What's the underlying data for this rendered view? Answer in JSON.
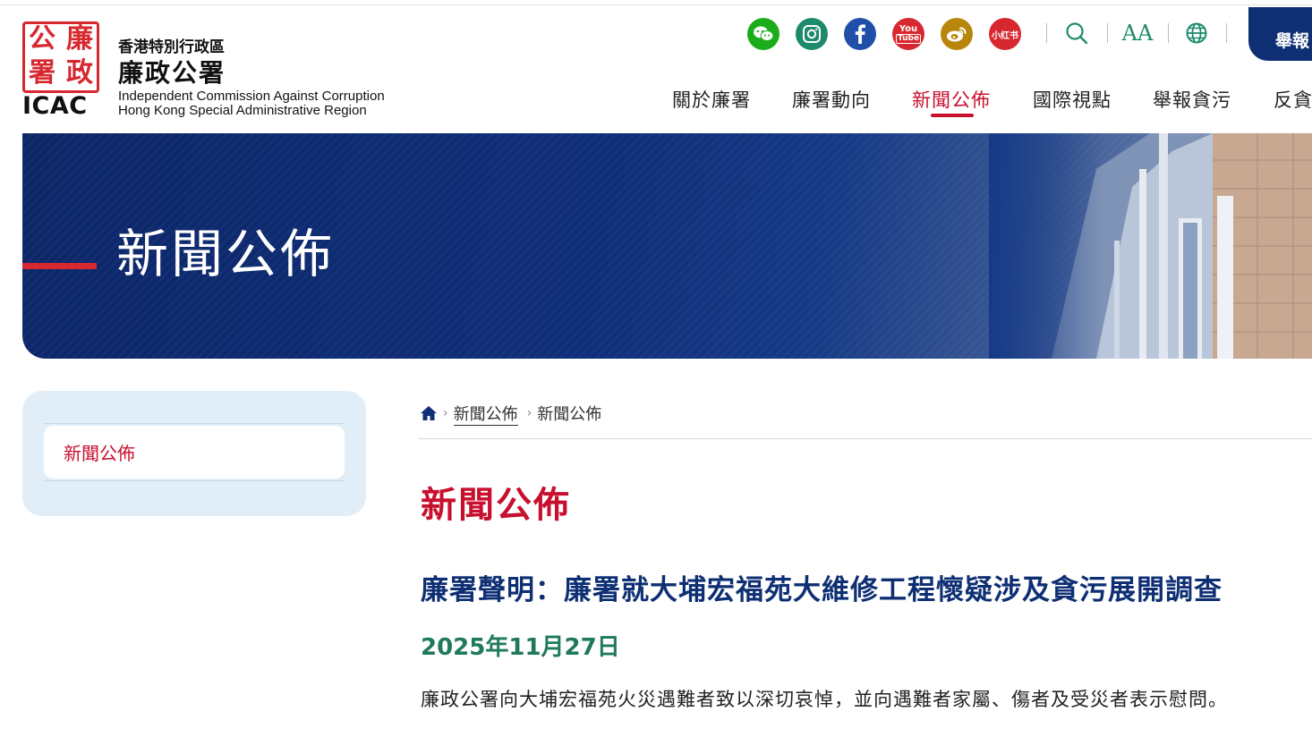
{
  "logo": {
    "seal_chars": [
      "廉",
      "政",
      "公",
      "署"
    ],
    "icac": "ICAC",
    "org_zh_small": "香港特別行政區",
    "org_zh_big": "廉政公署",
    "org_en_line1": "Independent Commission Against Corruption",
    "org_en_line2": "Hong Kong Special Administrative Region"
  },
  "social": {
    "wechat": {
      "icon": "wechat-icon",
      "color": "#1aad19"
    },
    "instagram": {
      "icon": "instagram-icon",
      "color": "#1d8a6b"
    },
    "facebook": {
      "icon": "facebook-icon",
      "color": "#1f4fa8"
    },
    "youtube": {
      "icon": "youtube-icon",
      "color": "#d7282f",
      "text_top": "You",
      "text_bottom": "Tube"
    },
    "weibo": {
      "icon": "weibo-icon",
      "color": "#b8860b"
    },
    "xiaohongshu": {
      "icon": "xiaohongshu-icon",
      "color": "#d7282f",
      "text": "小红书"
    }
  },
  "tools": {
    "search": "search-icon",
    "font_size": "text-size-icon",
    "font_size_label": "AA",
    "language": "globe-icon",
    "accent": "#1d8a6b"
  },
  "report_button": {
    "label": "舉報"
  },
  "nav": {
    "items": [
      "關於廉署",
      "廉署動向",
      "新聞公佈",
      "國際視點",
      "舉報貪污",
      "反貪"
    ],
    "active_index": 2
  },
  "banner": {
    "title": "新聞公佈"
  },
  "sidebar": {
    "items": [
      "新聞公佈"
    ]
  },
  "breadcrumb": {
    "home": "home-icon",
    "items": [
      "新聞公佈",
      "新聞公佈"
    ]
  },
  "content": {
    "page_title": "新聞公佈",
    "headline": "廉署聲明：廉署就大埔宏福苑大維修工程懷疑涉及貪污展開調查",
    "date": "2025年11月27日",
    "body": "廉政公署向大埔宏福苑火災遇難者致以深切哀悼，並向遇難者家屬、傷者及受災者表示慰問。"
  },
  "colors": {
    "brand_red": "#c8102e",
    "navy": "#0e2f73",
    "green": "#1f7a5c",
    "sidebar_bg": "#e2eef7"
  }
}
